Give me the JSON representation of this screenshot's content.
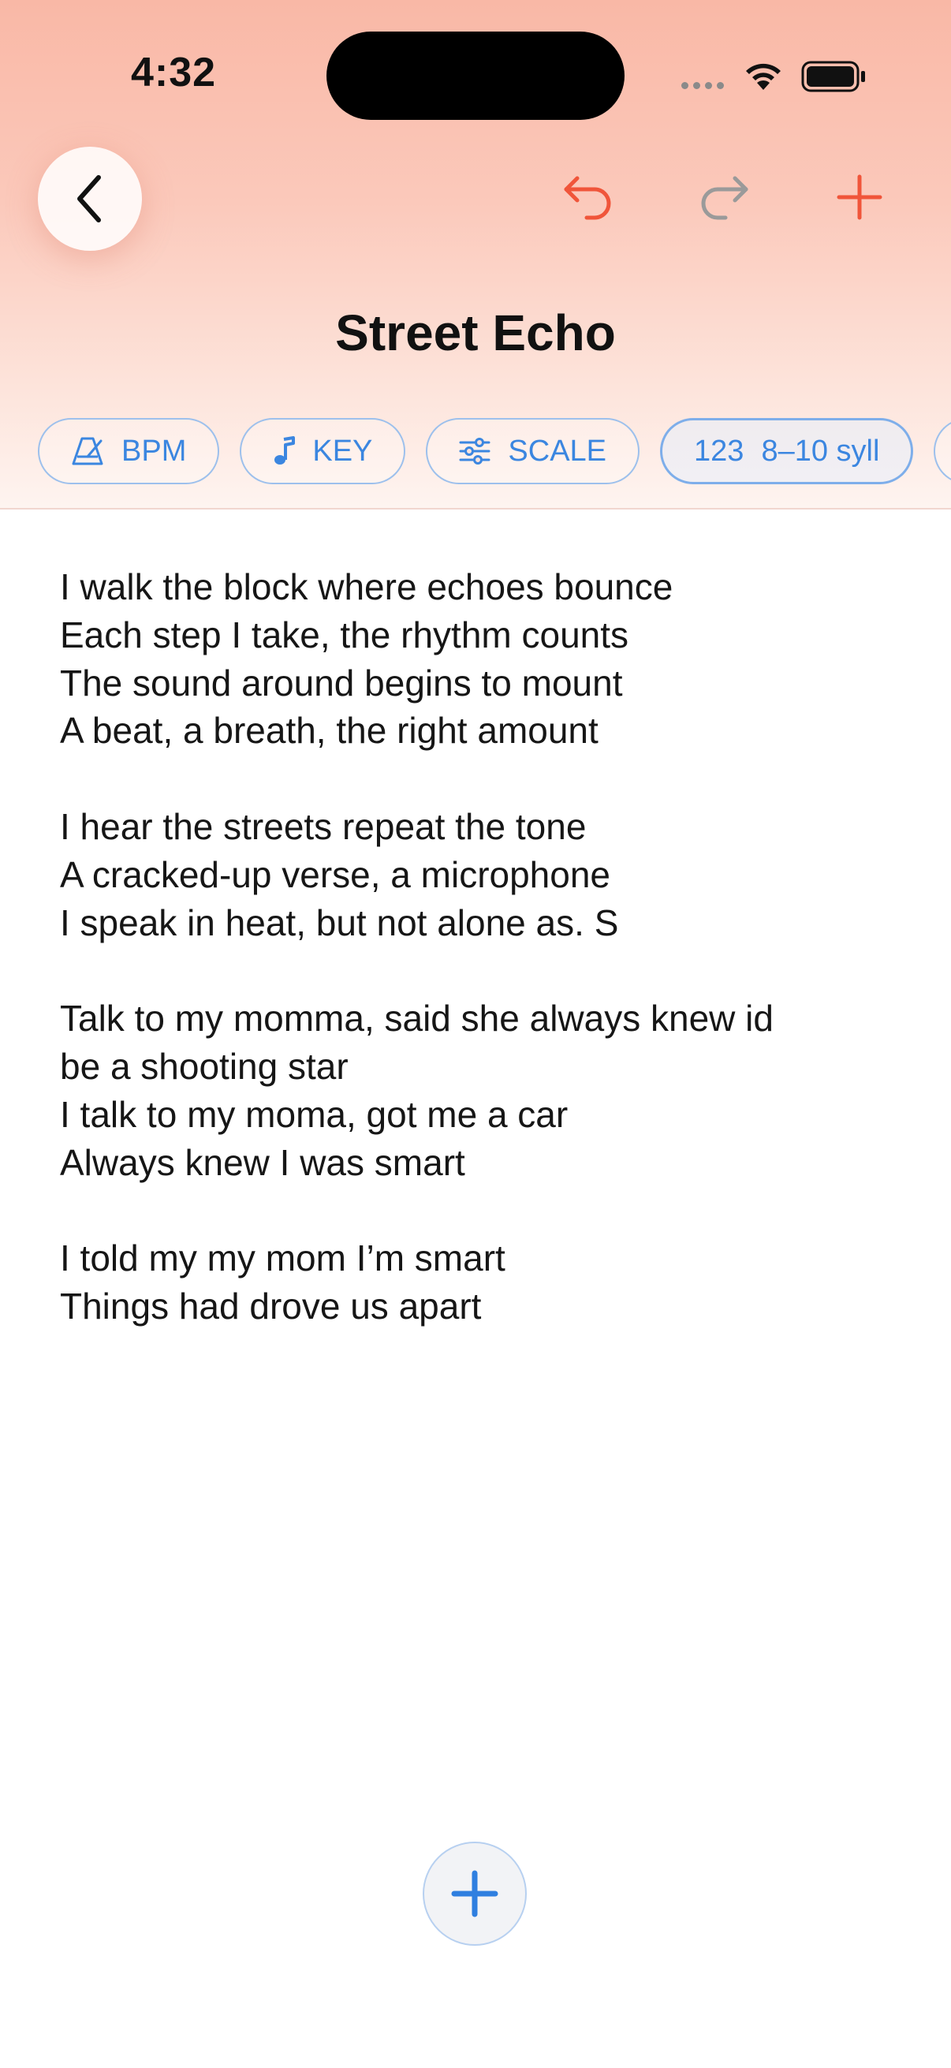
{
  "status_bar": {
    "time": "4:32"
  },
  "toolbar": {
    "back_icon": "chevron-left-icon",
    "undo_icon": "undo-icon",
    "redo_icon": "redo-icon",
    "add_icon": "plus-icon",
    "accent_color": "#f0553a",
    "disabled_color": "#9a9a9a"
  },
  "page": {
    "title": "Street Echo"
  },
  "chips": [
    {
      "label": "BPM",
      "icon": "metronome-icon"
    },
    {
      "label": "KEY",
      "icon": "music-note-icon"
    },
    {
      "label": "SCALE",
      "icon": "sliders-icon"
    },
    {
      "prefix": "123",
      "label": "8–10 syll",
      "selected": true
    }
  ],
  "colors": {
    "chip_accent": "#3b86e0",
    "header_top": "#f9b8a6"
  },
  "lyrics": {
    "stanzas": [
      {
        "lines": [
          "I walk the block where echoes bounce",
          "Each step I take, the rhythm counts",
          "The sound around begins to mount",
          "A beat, a breath, the right amount"
        ]
      },
      {
        "lines": [
          "I hear the streets repeat the tone",
          "A cracked-up verse, a microphone",
          "I speak in heat, but not alone as. S"
        ]
      },
      {
        "lines": [
          "Talk to my momma, said she always knew id",
          "be a shooting star",
          "I talk to my moma, got me a car",
          "Always knew I was smart"
        ]
      },
      {
        "lines": [
          "I told my my mom I’m smart",
          "Things had drove us apart"
        ]
      }
    ]
  },
  "fab": {
    "icon": "plus-icon"
  }
}
